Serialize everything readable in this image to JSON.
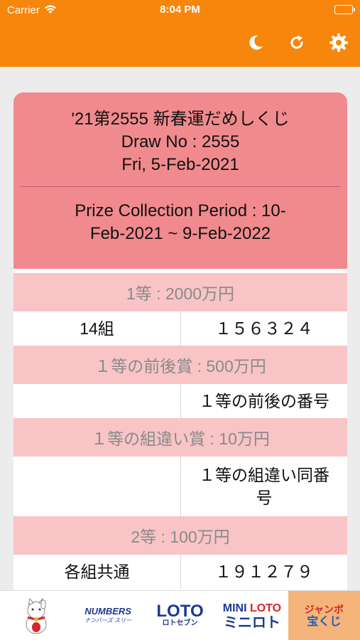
{
  "status": {
    "carrier": "Carrier",
    "time": "8:04 PM"
  },
  "nav": {
    "icons": [
      "moon-icon",
      "refresh-icon",
      "gear-icon"
    ],
    "bar_color": "#f7860c"
  },
  "draw": {
    "title": "'21第2555 新春運だめしくじ",
    "draw_no": "Draw No : 2555",
    "date": "Fri, 5-Feb-2021",
    "period_line1": "Prize Collection Period : 10-",
    "period_line2": "Feb-2021 ~ 9-Feb-2022"
  },
  "prizes": [
    {
      "name": "1等 : 2000万円",
      "left": "14組",
      "right": "１５６３２４"
    },
    {
      "name": "１等の前後賞 : 500万円",
      "left": "",
      "right": "１等の前後の番号"
    },
    {
      "name": "１等の組違い賞 : 10万円",
      "left": "",
      "right_line1": "１等の組違い同番",
      "right_line2": "号"
    },
    {
      "name": "2等 : 100万円",
      "left": "各組共通",
      "right": "１９１２７９"
    }
  ],
  "tabs": [
    {
      "name": "maneki-neko",
      "label": ""
    },
    {
      "name": "numbers",
      "label": "NUMBERS",
      "sub": "ナンバーズ スリー"
    },
    {
      "name": "loto7",
      "label": "LOTO",
      "sub": "ロトセブン"
    },
    {
      "name": "mini-loto",
      "label_a": "MINI ",
      "label_b": "LOTO",
      "sub": "ミニロト"
    },
    {
      "name": "jumbo",
      "label": "ジャンボ",
      "sub": "宝くじ"
    }
  ],
  "colors": {
    "accent": "#f7860c",
    "card_head": "#f18a8e",
    "prize_head": "#f8c4c6",
    "active_tab": "#f4b47a"
  }
}
